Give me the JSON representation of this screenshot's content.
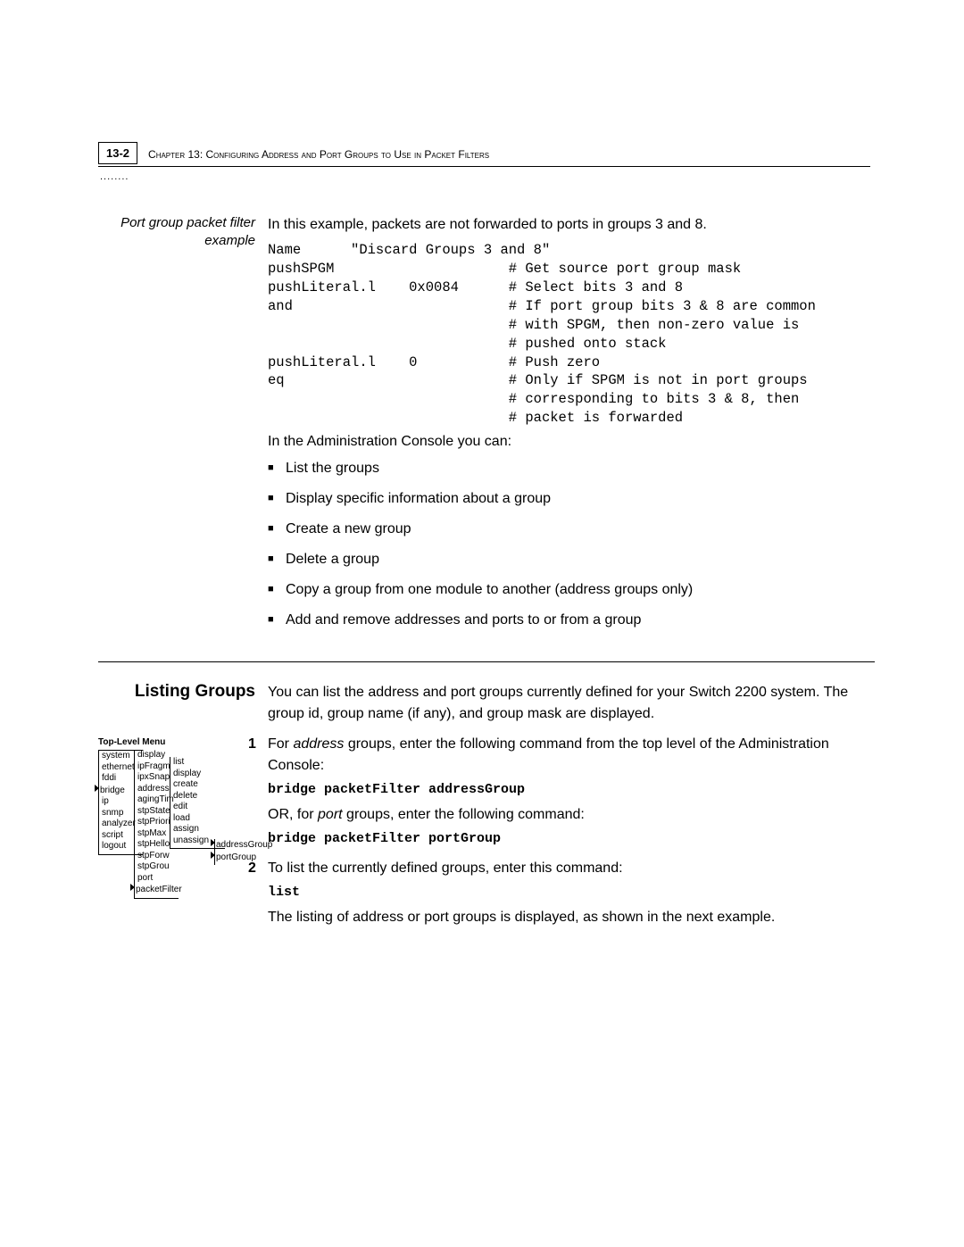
{
  "page_number": "13-2",
  "chapter_label": "Chapter 13: ",
  "chapter_title": "Configuring Address and Port Groups to Use in Packet Filters",
  "dotted": "........",
  "sidenote1": "Port group packet filter example",
  "intro1": "In this example, packets are not forwarded to ports in groups 3 and 8.",
  "codeblock": "Name      \"Discard Groups 3 and 8\"\npushSPGM                     # Get source port group mask\npushLiteral.l    0x0084      # Select bits 3 and 8\nand                          # If port group bits 3 & 8 are common\n                             # with SPGM, then non-zero value is\n                             # pushed onto stack\npushLiteral.l    0           # Push zero\neq                           # Only if SPGM is not in port groups\n                             # corresponding to bits 3 & 8, then\n                             # packet is forwarded",
  "admin_intro": "In the Administration Console you can:",
  "bullets": [
    "List the groups",
    "Display specific information about a group",
    "Create a new group",
    "Delete a group",
    "Copy a group from one module to another (address groups only)",
    "Add and remove addresses and ports to or from a group"
  ],
  "section_heading": "Listing Groups",
  "section_body": "You can list the address and port groups currently defined for your Switch 2200 system. The group id, group name (if any), and group mask are displayed.",
  "step1_a": "For ",
  "step1_b_italic": "address",
  "step1_c": " groups, enter the following command from the top level of the Administration Console:",
  "cmd1": "bridge packetFilter addressGroup",
  "step1_d": "OR, for ",
  "step1_e_italic": "port",
  "step1_f": " groups, enter the following command:",
  "cmd2": "bridge packetFilter portGroup",
  "step2_a": "To list the currently defined groups, enter this command:",
  "cmd3": "list",
  "step2_b": "The listing of address or port groups is displayed, as shown in the next example.",
  "menu": {
    "title": "Top-Level Menu",
    "col1": [
      "system",
      "ethernet",
      "fddi",
      "bridge",
      "ip",
      "snmp",
      "analyzer",
      "script",
      "logout"
    ],
    "col1_arrow": "bridge",
    "col2": [
      "display",
      "ipFragm",
      "ipxSnap",
      "address",
      "agingTim",
      "stpState",
      "stpPriori",
      "stpMax",
      "stpHello",
      "stpForw",
      "stpGrou",
      "port",
      "packetFilter"
    ],
    "col2_arrow": "packetFilter",
    "col3": [
      "list",
      "display",
      "create",
      "delete",
      "edit",
      "load",
      "assign",
      "unassign",
      "addressGroup",
      "portGroup"
    ],
    "col3_arrows": [
      "addressGroup",
      "portGroup"
    ]
  }
}
